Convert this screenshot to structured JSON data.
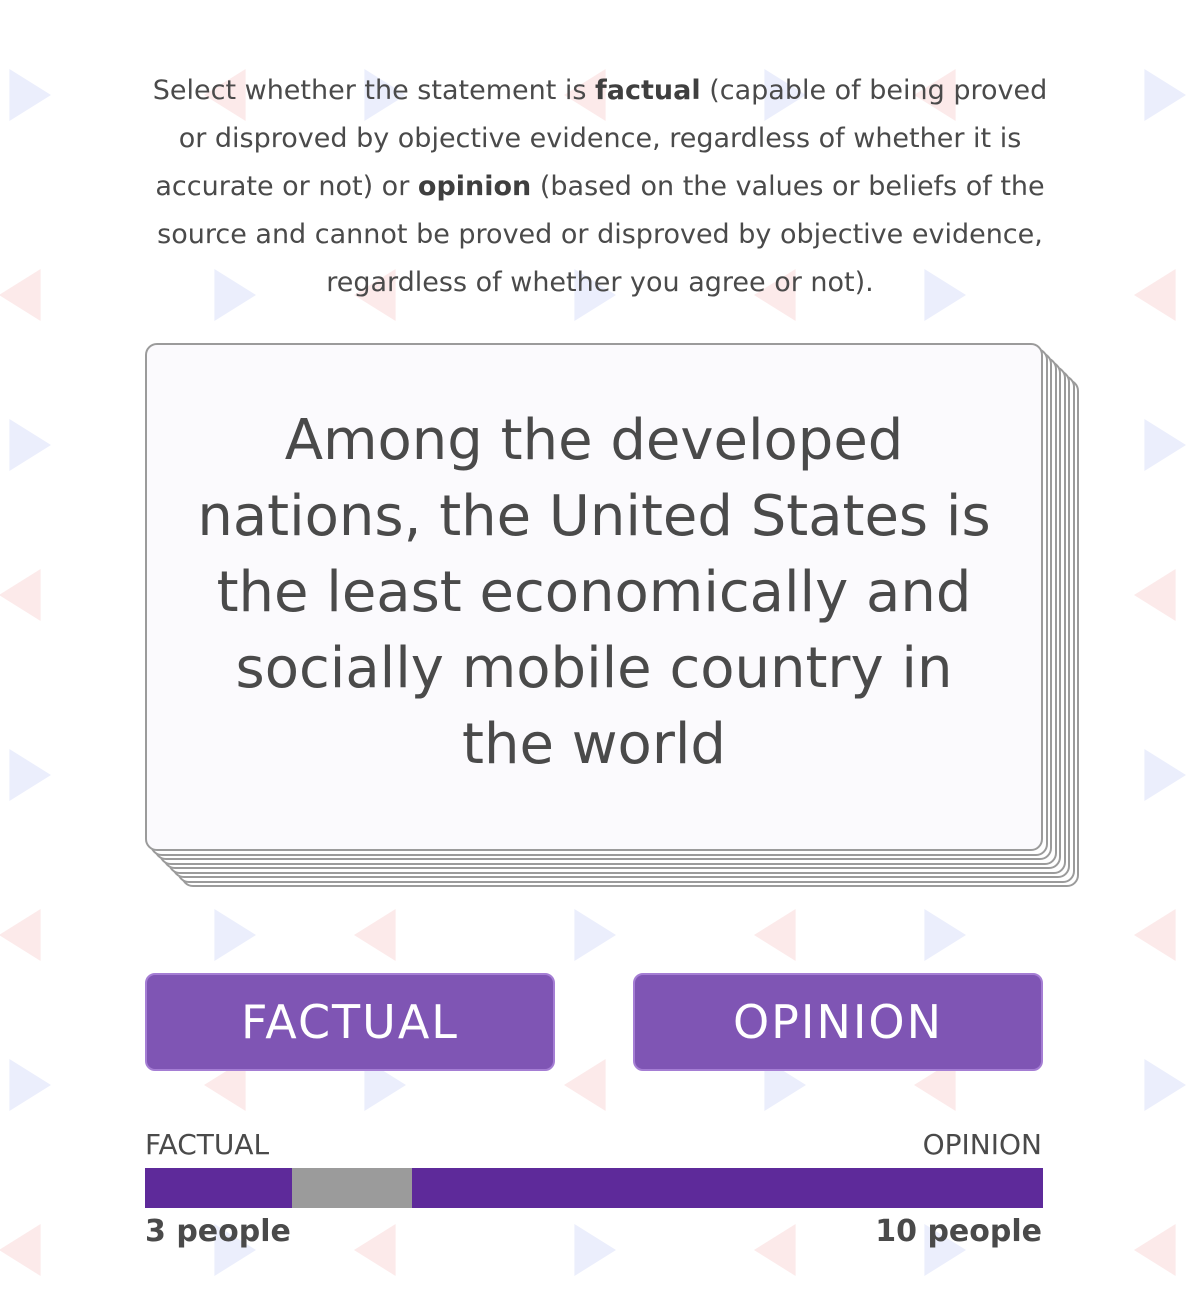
{
  "instructions": {
    "part1": "Select whether the statement is ",
    "factual_word": "factual",
    "part2": " (capable of being proved or disproved by objective evidence, regardless of whether it is accurate or not) or ",
    "opinion_word": "opinion",
    "part3": " (based on the values or beliefs of the source and cannot be proved or disproved by objective evidence, regardless of whether you agree or not)."
  },
  "card": {
    "statement": "Among the developed nations, the United States is the least economically and socially mobile country in the world"
  },
  "buttons": {
    "factual_label": "FACTUAL",
    "opinion_label": "OPINION"
  },
  "results": {
    "factual_label": "FACTUAL",
    "opinion_label": "OPINION",
    "factual_count": "3 people",
    "opinion_count": "10 people",
    "factual_votes": 3,
    "opinion_votes": 10
  },
  "colors": {
    "accent": "#7f55b4",
    "bar": "#5e2a9a",
    "marker": "#9b9b9b",
    "pattern_blue": "#e4e8fb",
    "pattern_red": "#fbe3e3"
  }
}
